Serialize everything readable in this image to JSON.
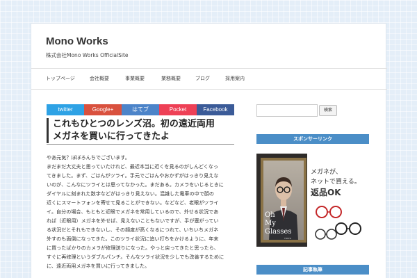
{
  "header": {
    "site_title": "Mono Works",
    "site_description": "株式会社Mono Works OfficialSite"
  },
  "nav": {
    "items": [
      {
        "label": "トップページ"
      },
      {
        "label": "会社概要"
      },
      {
        "label": "事業概要"
      },
      {
        "label": "業務概要"
      },
      {
        "label": "ブログ"
      },
      {
        "label": "採用案内"
      }
    ]
  },
  "share": {
    "buttons": [
      {
        "label": "twitter",
        "color": "#2ea2e5"
      },
      {
        "label": "Google+",
        "color": "#d9513e"
      },
      {
        "label": "はてブ",
        "color": "#4c84c9"
      },
      {
        "label": "Pocket",
        "color": "#ee4056"
      },
      {
        "label": "Facebook",
        "color": "#3b5b98"
      }
    ]
  },
  "post": {
    "title_line1": "これもひとつのレンズ沼。初の遠近両用",
    "title_line2": "メガネを買いに行ってきたよ",
    "body_lines": [
      "やあ元気？ぼぼろんちでございます。",
      "まだまだ大丈夫と思っていたけれど、最近本当に近くを見るのがしんどくなっ",
      "てきました。まず、ごはんがツライ。手元でごはんやおかずがはっきり見えな",
      "いのが、こんなにツライとは思ってなかった。まだある。カメラをいじるときに",
      "ダイヤルに刻まれた数字などがはっきり見えない。混雑した電車の中で顔の",
      "近くにスマートフォンを寄せて見ることができない。などなど、老眼がツライ",
      "イ。自分の場合、もともと近眼でメガネを常用しているので、外せる状況であ",
      "れば（近眼用）メガネを外せば、見えないこともないですが、手が塞がってい",
      "る状況だとそれもできないし、その頻度が高くなるにつれて、いちいちメガネ",
      "外すのも面倒になってきた。このツライ状況に追い打ちをかけるように、年末",
      "に買ったばかりのカメラが修理送りになった。やっと戻ってきたと思ったら、",
      "すぐに再修理というダブルパンチ。そんなツライ状況を少しでも改善するために",
      "に、遠近両用メガネを買いに行ってきました。"
    ]
  },
  "sidebar": {
    "search_button_label": "検索",
    "search_placeholder": "",
    "sponsor_heading": "スポンサーリンク",
    "recent_heading": "記事執筆"
  },
  "ad": {
    "tagline_line1": "メガネが、",
    "tagline_line2": "ネットで買える。",
    "tagline_line3": "返品OK",
    "brand_line1": "Oh",
    "brand_line2": "My",
    "brand_line3": "Glasses",
    "brand_small": "TOKYO"
  }
}
